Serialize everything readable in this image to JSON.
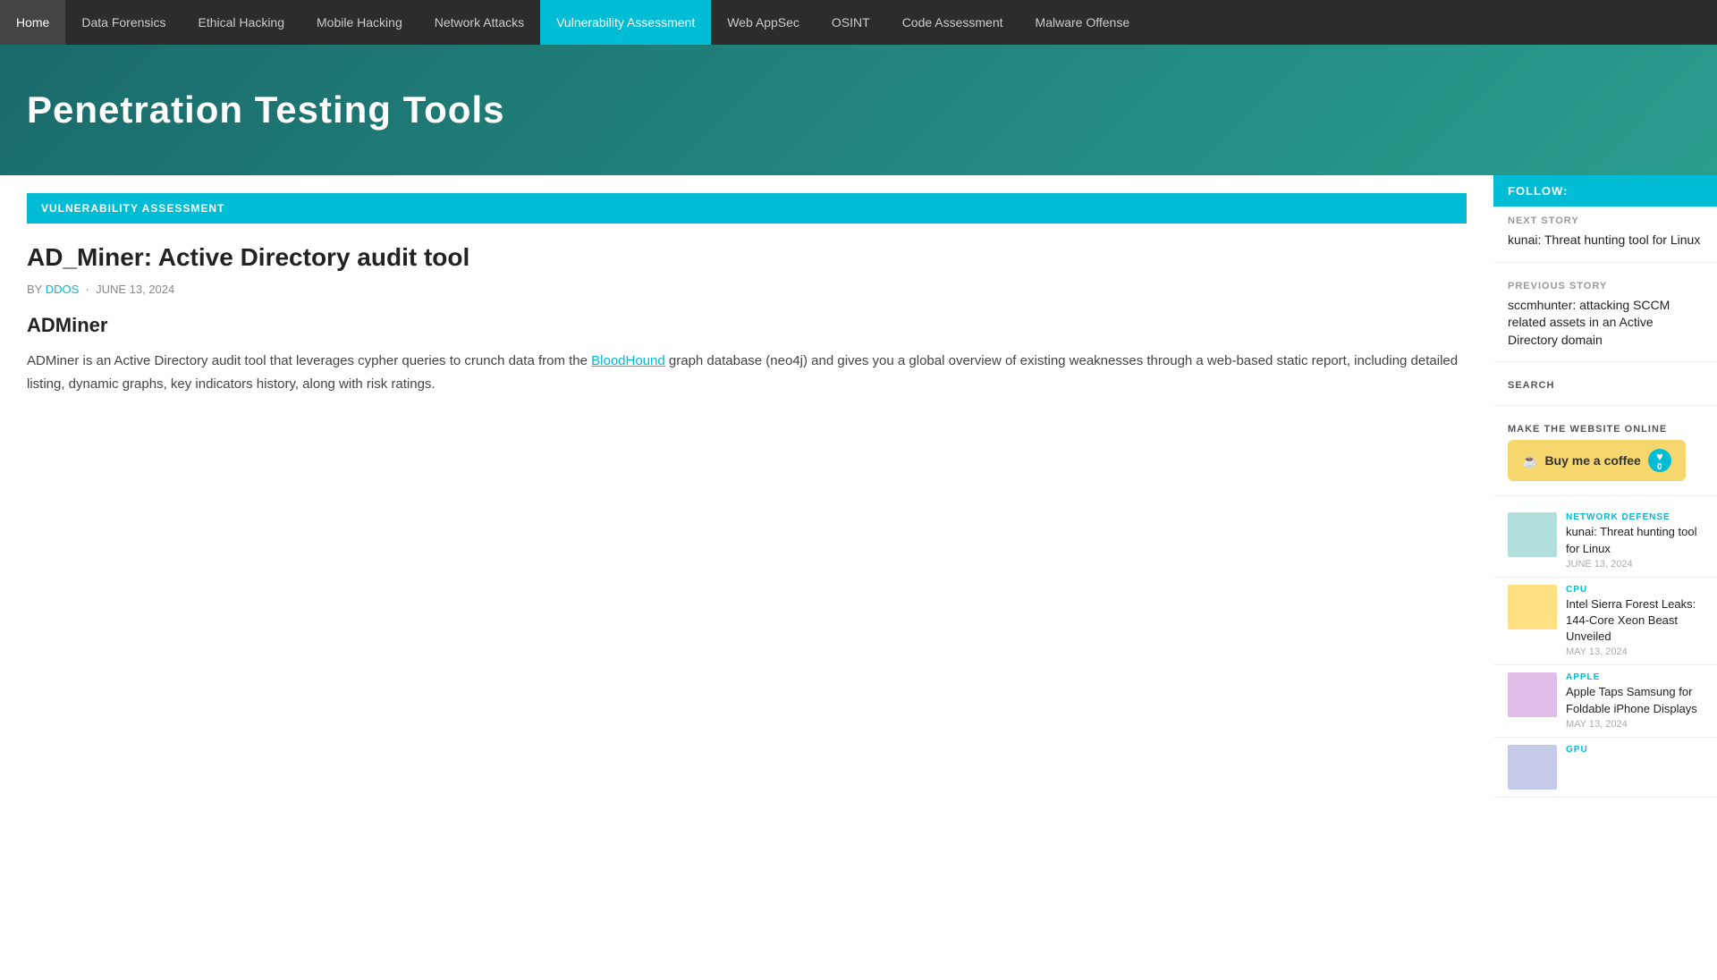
{
  "nav": {
    "items": [
      {
        "label": "Home",
        "active": false
      },
      {
        "label": "Data Forensics",
        "active": false
      },
      {
        "label": "Ethical Hacking",
        "active": false
      },
      {
        "label": "Mobile Hacking",
        "active": false
      },
      {
        "label": "Network Attacks",
        "active": false
      },
      {
        "label": "Vulnerability Assessment",
        "active": true
      },
      {
        "label": "Web AppSec",
        "active": false
      },
      {
        "label": "OSINT",
        "active": false
      },
      {
        "label": "Code Assessment",
        "active": false
      },
      {
        "label": "Malware Offense",
        "active": false
      }
    ]
  },
  "header": {
    "site_title": "Penetration Testing Tools"
  },
  "category": {
    "label": "VULNERABILITY ASSESSMENT"
  },
  "article": {
    "title": "AD_Miner: Active Directory audit tool",
    "author": "DDOS",
    "date": "JUNE 13, 2024",
    "section_heading": "ADMiner",
    "body_text": "ADMiner is an Active Directory audit tool that leverages cypher queries to crunch data from the BloodHound graph database (neo4j) and gives you a global overview of existing weaknesses through a web-based static report, including detailed listing, dynamic graphs, key indicators history, along with risk ratings.",
    "bloodhound_link": "BloodHound"
  },
  "sidebar": {
    "follow_label": "FOLLOW:",
    "next_story_label": "NEXT STORY",
    "next_story_title": "kunai: Threat hunting tool for Linux",
    "prev_story_label": "PREVIOUS STORY",
    "prev_story_title": "sccmhunter: attacking SCCM related assets in an Active Directory domain",
    "search_label": "SEARCH",
    "make_online_label": "MAKE THE WEBSITE ONLINE",
    "buy_coffee_label": "Buy me a coffee",
    "heart_icon": "♥",
    "heart_count": "0",
    "news_items": [
      {
        "category": "NETWORK DEFENSE",
        "title": "kunai: Threat hunting tool for Linux",
        "date": "JUNE 13, 2024"
      },
      {
        "category": "CPU",
        "title": "Intel Sierra Forest Leaks: 144-Core Xeon Beast Unveiled",
        "date": "MAY 13, 2024"
      },
      {
        "category": "APPLE",
        "title": "Apple Taps Samsung for Foldable iPhone Displays",
        "date": "MAY 13, 2024"
      },
      {
        "category": "GPU",
        "title": "",
        "date": ""
      }
    ]
  }
}
